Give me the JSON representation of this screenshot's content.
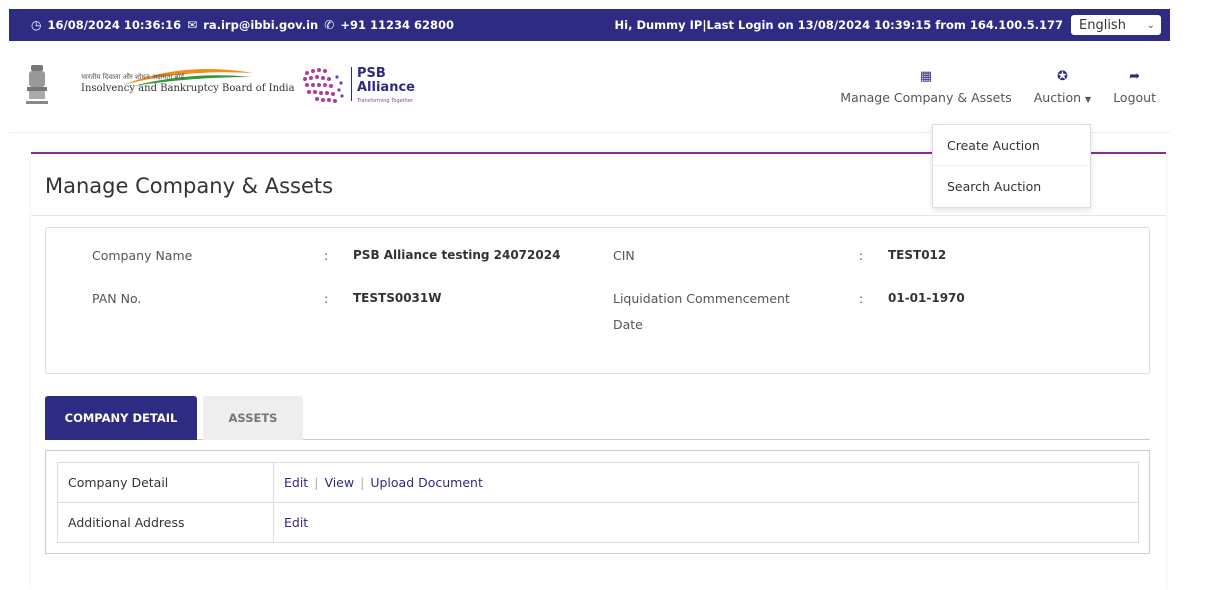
{
  "topbar": {
    "datetime": "16/08/2024 10:36:16",
    "email": "ra.irp@ibbi.gov.in",
    "phone": "+91 11234 62800",
    "welcome": "Hi, Dummy IP|Last Login on 13/08/2024 10:39:15 from 164.100.5.177",
    "language": "English"
  },
  "header": {
    "ibbi_hindi": "भारतीय दिवाला और शोधन अक्षमता बोर्ड",
    "ibbi_name": "Insolvency and Bankruptcy Board of India",
    "psb_line1": "PSB",
    "psb_line2": "Alliance",
    "psb_tagline": "Transforming Together"
  },
  "nav": {
    "manage": "Manage Company & Assets",
    "auction": "Auction",
    "logout": "Logout"
  },
  "auction_menu": [
    "Create Auction",
    "Search Auction"
  ],
  "page": {
    "title": "Manage Company & Assets"
  },
  "company": {
    "name_label": "Company Name",
    "name_value": "PSB Alliance testing 24072024",
    "cin_label": "CIN",
    "cin_value": "TEST012",
    "pan_label": "PAN No.",
    "pan_value": "TESTS0031W",
    "liq_label_1": "Liquidation Commencement",
    "liq_label_2": "Date",
    "liq_value": "01-01-1970",
    "colon": ":"
  },
  "tabs": {
    "company_detail": "COMPANY DETAIL",
    "assets": "ASSETS"
  },
  "table": {
    "row1_label": "Company Detail",
    "row1_edit": "Edit",
    "row1_view": "View",
    "row1_upload": "Upload Document",
    "row2_label": "Additional Address",
    "row2_edit": "Edit",
    "separator": "|"
  },
  "colors": {
    "primary": "#2e2b83",
    "accent": "#8a2c8e"
  }
}
